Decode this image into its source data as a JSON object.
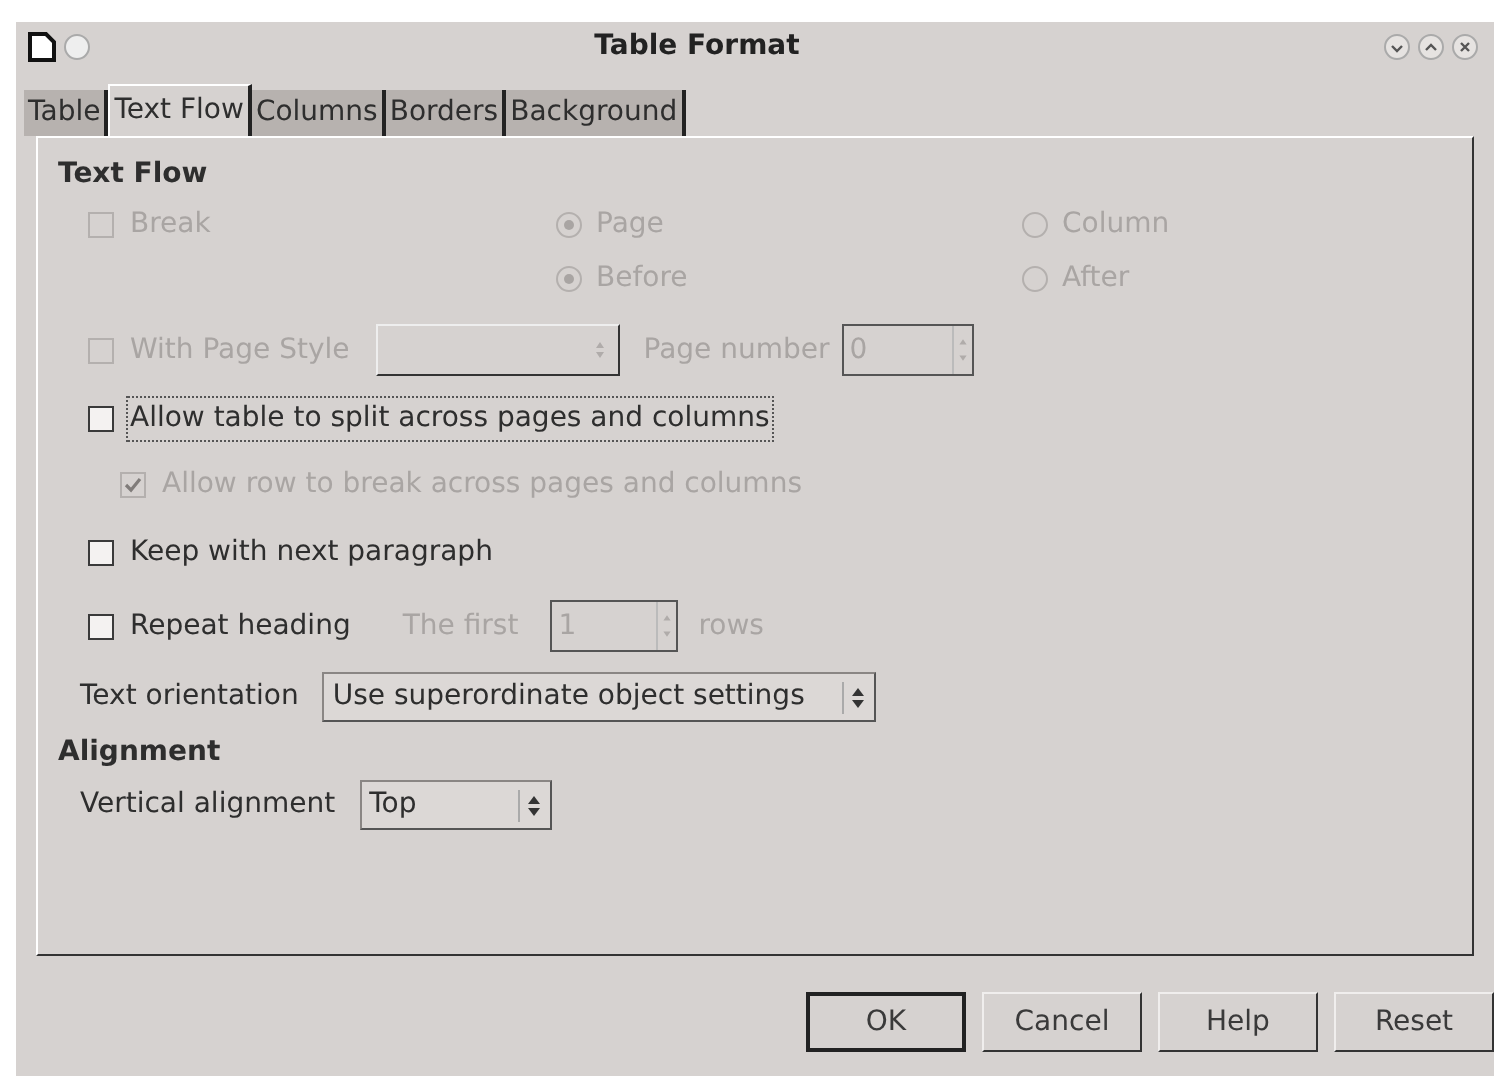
{
  "window": {
    "title": "Table Format"
  },
  "tabs": [
    {
      "label": "Table",
      "selected": false
    },
    {
      "label": "Text Flow",
      "selected": true
    },
    {
      "label": "Columns",
      "selected": false
    },
    {
      "label": "Borders",
      "selected": false
    },
    {
      "label": "Background",
      "selected": false
    }
  ],
  "text_flow": {
    "heading": "Text Flow",
    "break": {
      "label": "Break",
      "checked": false,
      "disabled": true
    },
    "break_type": [
      {
        "label": "Page",
        "selected": true,
        "disabled": true
      },
      {
        "label": "Column",
        "selected": false,
        "disabled": true
      }
    ],
    "position": [
      {
        "label": "Before",
        "selected": true,
        "disabled": true
      },
      {
        "label": "After",
        "selected": false,
        "disabled": true
      }
    ],
    "with_page_style": {
      "label": "With Page Style",
      "checked": false,
      "disabled": true
    },
    "page_style": {
      "disabled": true
    },
    "page_number": {
      "label": "Page number",
      "value": "0",
      "disabled": true
    },
    "allow_split": {
      "label": "Allow table to split across pages and columns",
      "checked": false,
      "disabled": false,
      "focused": true
    },
    "allow_row_break": {
      "label": "Allow row to break across pages and columns",
      "checked": true,
      "disabled": true
    },
    "keep_with_next": {
      "label": "Keep with next paragraph",
      "checked": false,
      "disabled": false
    },
    "repeat_heading": {
      "label": "Repeat heading",
      "checked": false,
      "disabled": false
    },
    "first_rows": {
      "label": "The first",
      "value": "1",
      "suffix": "rows",
      "disabled": true
    },
    "text_orientation": {
      "label": "Text orientation",
      "value": "Use superordinate object settings"
    }
  },
  "alignment": {
    "heading": "Alignment",
    "vertical": {
      "label": "Vertical alignment",
      "value": "Top"
    }
  },
  "buttons": [
    {
      "label": "OK",
      "default": true
    },
    {
      "label": "Cancel",
      "default": false
    },
    {
      "label": "Help",
      "default": false
    },
    {
      "label": "Reset",
      "default": false
    }
  ]
}
